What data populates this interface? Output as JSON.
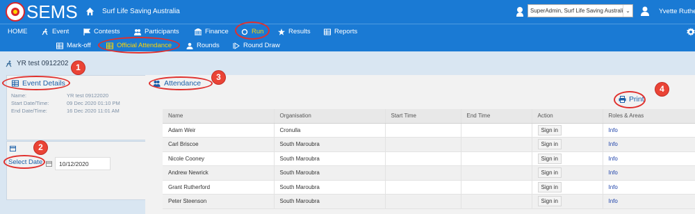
{
  "app": {
    "brand": "SEMS",
    "org_name": "Surf Life Saving Australia",
    "role_select_value": "SuperAdmin, Surf Life Saving Australi",
    "user_name": "Yvette Ruthe"
  },
  "nav": {
    "items": [
      {
        "label": "HOME",
        "icon": "none"
      },
      {
        "label": "Event",
        "icon": "runner-icon"
      },
      {
        "label": "Contests",
        "icon": "flag-icon"
      },
      {
        "label": "Participants",
        "icon": "users-icon"
      },
      {
        "label": "Finance",
        "icon": "bank-icon"
      },
      {
        "label": "Run",
        "icon": "circle-icon"
      },
      {
        "label": "Results",
        "icon": "star-icon"
      },
      {
        "label": "Reports",
        "icon": "table-icon"
      }
    ],
    "active": "Run",
    "sub_items": [
      {
        "label": "Mark-off",
        "icon": "table-icon"
      },
      {
        "label": "Official Attendance",
        "icon": "table-icon"
      },
      {
        "label": "Rounds",
        "icon": "user-icon"
      },
      {
        "label": "Round Draw",
        "icon": "play-icon"
      }
    ],
    "sub_active": "Official Attendance"
  },
  "breadcrumb": {
    "title": "YR test 0912202"
  },
  "event_details": {
    "title": "Event Details",
    "rows": [
      {
        "label": "Name:",
        "value": "YR test 09122020"
      },
      {
        "label": "Start Date/Time:",
        "value": "09 Dec 2020 01:10 PM"
      },
      {
        "label": "End Date/Time:",
        "value": "16 Dec 2020 11:01 AM"
      }
    ]
  },
  "date_select": {
    "label": "Select Date",
    "value": "10/12/2020"
  },
  "attendance": {
    "title": "Attendance",
    "print_label": "Print",
    "columns": [
      "Name",
      "Organisation",
      "Start Time",
      "End Time",
      "Action",
      "Roles & Areas"
    ],
    "rows": [
      {
        "name": "Adam Weir",
        "organisation": "Cronulla",
        "start": "",
        "end": "",
        "action": "Sign in",
        "roles": "Info"
      },
      {
        "name": "Carl Briscoe",
        "organisation": "South Maroubra",
        "start": "",
        "end": "",
        "action": "Sign in",
        "roles": "Info"
      },
      {
        "name": "Nicole Cooney",
        "organisation": "South Maroubra",
        "start": "",
        "end": "",
        "action": "Sign in",
        "roles": "Info"
      },
      {
        "name": "Andrew Newrick",
        "organisation": "South Maroubra",
        "start": "",
        "end": "",
        "action": "Sign in",
        "roles": "Info"
      },
      {
        "name": "Grant Rutherford",
        "organisation": "South Maroubra",
        "start": "",
        "end": "",
        "action": "Sign in",
        "roles": "Info"
      },
      {
        "name": "Peter Steenson",
        "organisation": "South Maroubra",
        "start": "",
        "end": "",
        "action": "Sign in",
        "roles": "Info"
      }
    ]
  },
  "annotations": [
    "1",
    "2",
    "3",
    "4"
  ],
  "colors": {
    "brand_blue": "#1a7ad4",
    "active_yellow": "#ffd500",
    "annotation_red": "#e0302d",
    "link_blue": "#1a5fa8"
  }
}
